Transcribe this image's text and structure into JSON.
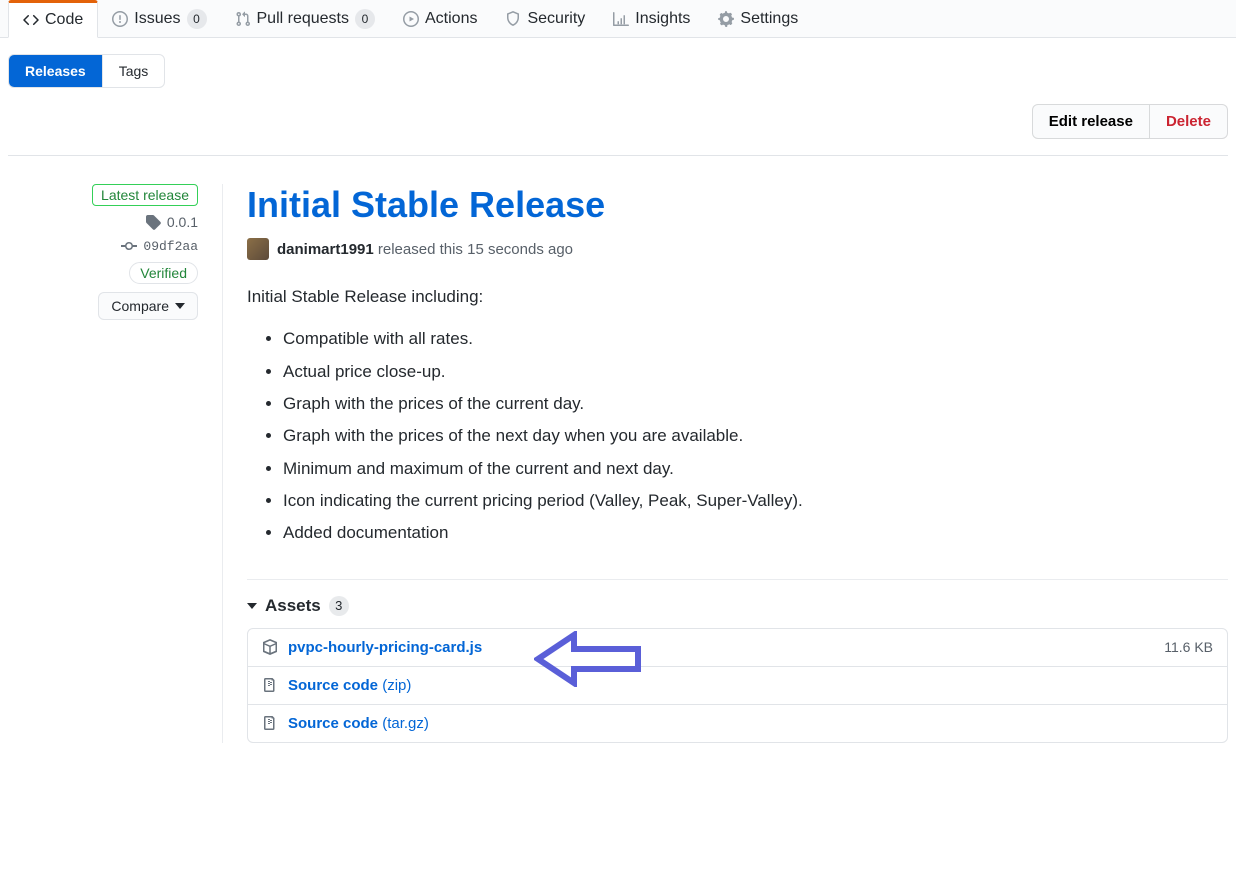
{
  "tabs": {
    "code": "Code",
    "issues": "Issues",
    "issues_count": "0",
    "pulls": "Pull requests",
    "pulls_count": "0",
    "actions": "Actions",
    "security": "Security",
    "insights": "Insights",
    "settings": "Settings"
  },
  "subnav": {
    "releases": "Releases",
    "tags": "Tags"
  },
  "actions": {
    "edit": "Edit release",
    "delete": "Delete"
  },
  "side": {
    "latest": "Latest release",
    "version": "0.0.1",
    "commit": "09df2aa",
    "verified": "Verified",
    "compare": "Compare"
  },
  "release": {
    "title": "Initial Stable Release",
    "author": "danimart1991",
    "meta_text": " released this 15 seconds ago",
    "desc_intro": "Initial Stable Release including:",
    "bullets": [
      "Compatible with all rates.",
      "Actual price close-up.",
      "Graph with the prices of the current day.",
      "Graph with the prices of the next day when you are available.",
      "Minimum and maximum of the current and next day.",
      "Icon indicating the current pricing period (Valley, Peak, Super-Valley).",
      "Added documentation"
    ],
    "assets_label": "Assets",
    "assets_count": "3",
    "assets": [
      {
        "name": "pvpc-hourly-pricing-card.js",
        "ext": "",
        "size": "11.6 KB",
        "icon": "package"
      },
      {
        "name": "Source code",
        "ext": "(zip)",
        "size": "",
        "icon": "zip"
      },
      {
        "name": "Source code",
        "ext": "(tar.gz)",
        "size": "",
        "icon": "zip"
      }
    ]
  }
}
